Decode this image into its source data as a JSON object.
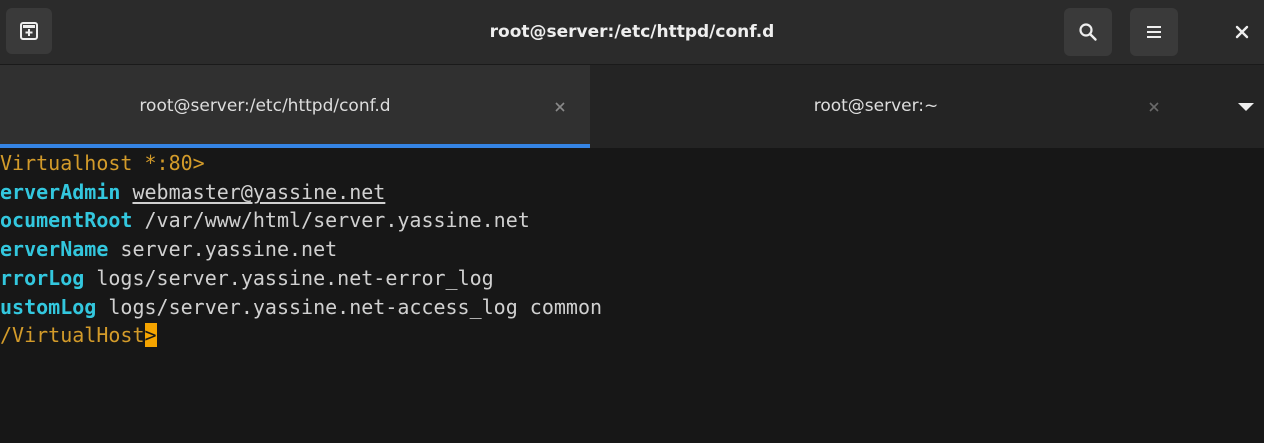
{
  "window": {
    "title": "root@server:/etc/httpd/conf.d"
  },
  "headerbar": {
    "icons": [
      "new-tab-icon",
      "search-icon",
      "hamburger-menu-icon",
      "close-icon"
    ]
  },
  "tabs": [
    {
      "label": "root@server:/etc/httpd/conf.d",
      "active": true
    },
    {
      "label": "root@server:~",
      "active": false
    }
  ],
  "colors": {
    "headerbar_bg": "#2b2b2b",
    "tabbar_bg": "#242424",
    "active_tab_bg": "#303030",
    "active_tab_indicator": "#3584e4",
    "terminal_bg": "#171717",
    "tag_color": "#d39b2a",
    "directive_color": "#33c7de",
    "text_color": "#d0d0d0",
    "cursor_color": "#f5a400"
  },
  "terminal": {
    "lines": [
      {
        "tag": "Virtualhost",
        "addr": " *:80>"
      },
      {
        "key": "erverAdmin",
        "value": "webmaster@yassine.net"
      },
      {
        "key": "ocumentRoot",
        "value": " /var/www/html/server.yassine.net"
      },
      {
        "key": "erverName",
        "value": " server.yassine.net"
      },
      {
        "key": "rrorLog",
        "value": " logs/server.yassine.net-error_log"
      },
      {
        "key": "ustomLog",
        "value": " logs/server.yassine.net-access_log common"
      },
      {
        "tag": "/VirtualHost",
        "cursor": ">"
      }
    ]
  }
}
